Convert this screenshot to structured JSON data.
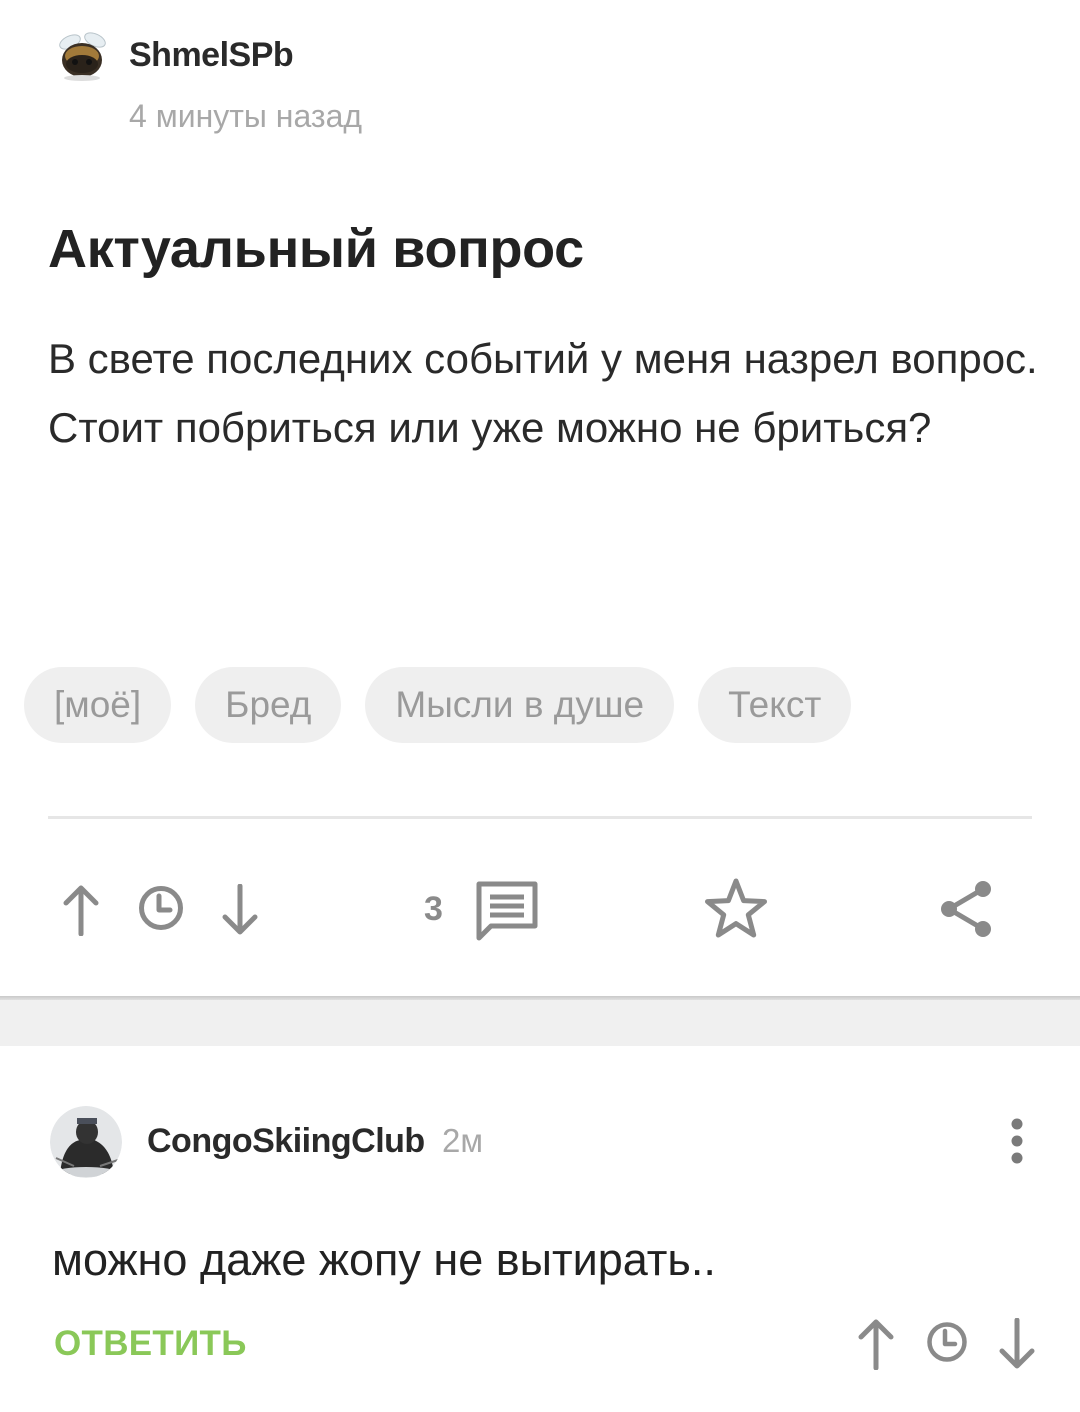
{
  "post": {
    "author": "ShmelSPb",
    "time": "4 минуты назад",
    "title": "Актуальный вопрос",
    "body_lines": [
      "В свете последних событий у меня назрел вопрос.",
      "Стоит побриться или уже можно не бриться?"
    ],
    "tags": [
      "[моё]",
      "Бред",
      "Мысли в душе",
      "Текст"
    ],
    "comments_count": "3",
    "icons": {
      "upvote": "arrow-up-icon",
      "later": "clock-icon",
      "downvote": "arrow-down-icon",
      "comments": "comment-icon",
      "save": "star-icon",
      "share": "share-icon"
    }
  },
  "comment": {
    "author": "CongoSkiingClub",
    "time": "2м",
    "text": "можно даже жопу не вытирать..",
    "reply_label": "ОТВЕТИТЬ",
    "icons": {
      "more": "more-vertical-icon",
      "upvote": "arrow-up-icon",
      "later": "clock-icon",
      "downvote": "arrow-down-icon"
    }
  },
  "colors": {
    "accent_green": "#8ac858",
    "icon_gray": "#8a8a8a",
    "tag_bg": "#efefef",
    "muted_text": "#a8a8a8"
  }
}
